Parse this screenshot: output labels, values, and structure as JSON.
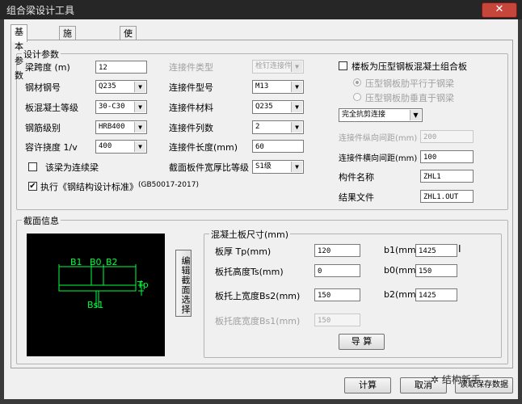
{
  "window": {
    "title": "组合梁设计工具",
    "close_glyph": "✕"
  },
  "tabs": [
    "基本参数",
    "施工阶段验算",
    "使用阶段验算"
  ],
  "design_params": {
    "group_title": "设计参数",
    "span_label": "梁跨度 (m)",
    "span_value": "12",
    "steel_grade_label": "钢材钢号",
    "steel_grade_value": "Q235",
    "concrete_grade_label": "板混凝土等级",
    "concrete_grade_value": "30-C30",
    "rebar_grade_label": "钢筋级别",
    "rebar_grade_value": "HRB400",
    "deflection_label": "容许挠度 1/v",
    "deflection_value": "400",
    "continuous_beam_label": "该梁为连续梁",
    "continuous_beam_checked": false,
    "standard_label": "执行《钢结构设计标准》",
    "standard_code": "(GB50017-2017)",
    "standard_checked": true,
    "connector_type_label": "连接件类型",
    "connector_type_value": "栓钉连接件",
    "connector_model_label": "连接件型号",
    "connector_model_value": "M13",
    "connector_material_label": "连接件材料",
    "connector_material_value": "Q235",
    "connector_rows_label": "连接件列数",
    "connector_rows_value": "2",
    "connector_length_label": "连接件长度(mm)",
    "connector_length_value": "60",
    "width_thickness_label": "截面板件宽厚比等级",
    "width_thickness_value": "S1级",
    "composite_slab_label": "楼板为压型钢板混凝土组合板",
    "composite_slab_checked": false,
    "rib_parallel_label": "压型钢板肋平行于钢梁",
    "rib_perpendicular_label": "压型钢板肋垂直于钢梁",
    "shear_connection_value": "完全抗剪连接",
    "long_spacing_label": "连接件纵向间距(mm)",
    "long_spacing_value": "200",
    "trans_spacing_label": "连接件横向间距(mm)",
    "trans_spacing_value": "100",
    "member_name_label": "构件名称",
    "member_name_value": "ZHL1",
    "result_file_label": "结果文件",
    "result_file_value": "ZHL1.OUT"
  },
  "section_info": {
    "group_title": "截面信息",
    "diagram_labels": {
      "b1": "B1",
      "b0": "B0",
      "b2": "B2",
      "tp": "Tp",
      "bs": "Bs1"
    },
    "diagram_color": "#00ff3c",
    "edit_button": "编辑截面选择"
  },
  "slab": {
    "group_title": "混凝土板尺寸(mm)",
    "tp_label": "板厚 Tp(mm)",
    "tp_value": "120",
    "ts_label": "板托高度Ts(mm)",
    "ts_value": "0",
    "bs2_label": "板托上宽度Bs2(mm)",
    "bs2_value": "150",
    "bs1_label": "板托底宽度Bs1(mm)",
    "bs1_value": "150",
    "b1_label": "b1(mm)",
    "b1_value": "1425",
    "b0_label": "b0(mm)",
    "b0_value": "150",
    "b2_label": "b2(mm)",
    "b2_value": "1425",
    "import_button": "导 算"
  },
  "footer": {
    "calc_button": "计算",
    "cancel_button": "取消",
    "read_button": "读取保存数据",
    "watermark": "结构新手"
  }
}
